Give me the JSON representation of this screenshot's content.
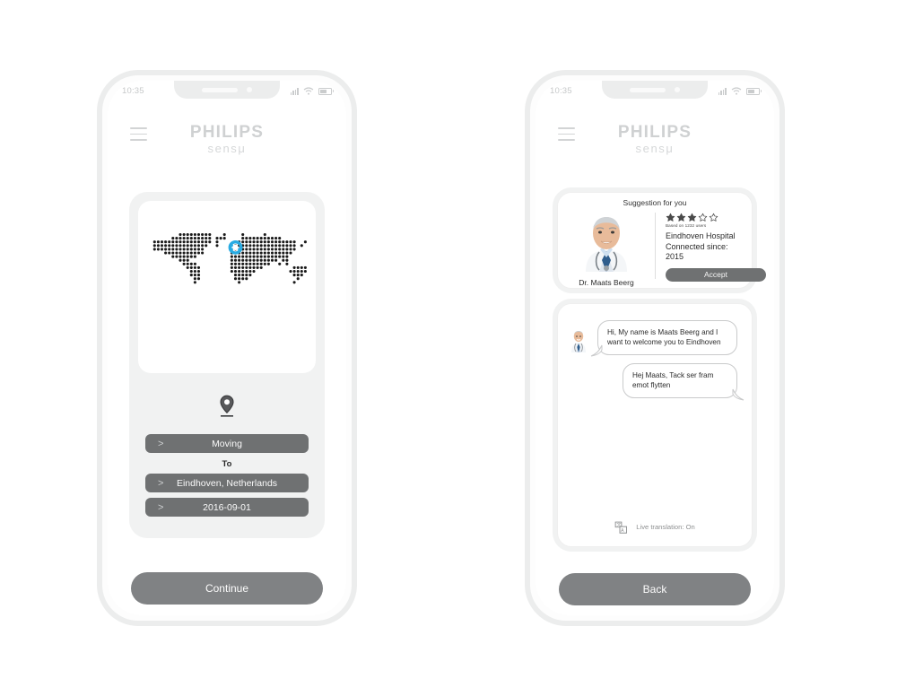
{
  "app": {
    "brand_name": "PHILIPS",
    "brand_sub": "sensμ"
  },
  "status_bar": {
    "time": "10:35",
    "signal_icon": "signal-bars-icon",
    "wifi_icon": "wifi-icon",
    "battery_icon": "battery-icon"
  },
  "left_screen": {
    "menu_icon": "hamburger-menu-icon",
    "map": {
      "icon": "dotted-world-map",
      "highlight_color": "#29abe2",
      "dot_color": "#1a1a1a",
      "highlight_label": "Eindhoven"
    },
    "pin_icon": "location-pin-icon",
    "fields": [
      {
        "chevron": ">",
        "value": "Moving",
        "name": "moving-field"
      },
      {
        "chevron": ">",
        "value": "Eindhoven, Netherlands",
        "name": "destination-field"
      },
      {
        "chevron": ">",
        "value": "2016-09-01",
        "name": "date-field"
      }
    ],
    "to_label": "To",
    "primary_button": "Continue"
  },
  "right_screen": {
    "menu_icon": "hamburger-menu-icon",
    "suggestion": {
      "title": "Suggestion for you",
      "doctor_name": "Dr. Maats Beerg",
      "doctor_photo_icon": "doctor-portrait",
      "rating_filled": 3,
      "rating_total": 5,
      "rating_caption": "Based on 1232 users",
      "hospital": "Eindhoven Hospital",
      "connected_since": "Connected since: 2015",
      "accept_button": "Accept",
      "star_color": "#4a4a4a"
    },
    "chat": {
      "avatar_icon": "doctor-avatar-icon",
      "messages": [
        {
          "from": "doctor",
          "text": "Hi, My name is Maats Beerg and I want to welcome you to Eindhoven"
        },
        {
          "from": "user",
          "text": "Hej Maats, Tack ser fram emot flytten"
        }
      ],
      "translation_icon": "translate-icon",
      "translation_status": "Live translation: On"
    },
    "primary_button": "Back"
  }
}
